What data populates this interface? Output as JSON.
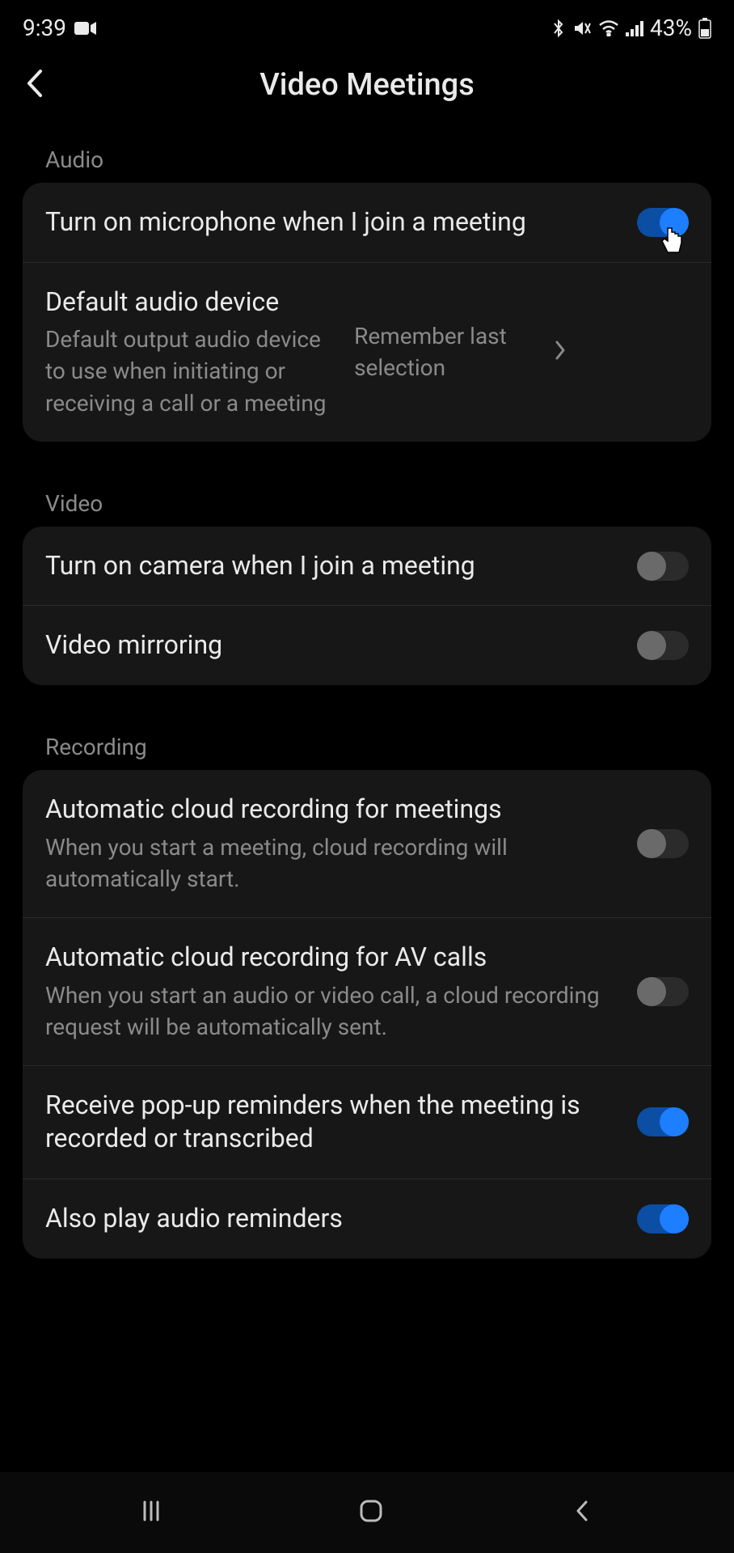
{
  "status": {
    "time": "9:39",
    "battery": "43%"
  },
  "header": {
    "title": "Video Meetings"
  },
  "sections": {
    "audio": {
      "label": "Audio",
      "mic_toggle": {
        "title": "Turn on microphone when I join a meeting"
      },
      "default_device": {
        "title": "Default audio device",
        "subtitle": "Default output audio device to use when initiating or receiving a call or a meeting",
        "value": "Remember last selection"
      }
    },
    "video": {
      "label": "Video",
      "camera_toggle": {
        "title": "Turn on camera when I join a meeting"
      },
      "mirroring": {
        "title": "Video mirroring"
      }
    },
    "recording": {
      "label": "Recording",
      "auto_meetings": {
        "title": "Automatic cloud recording for meetings",
        "subtitle": "When you start a meeting, cloud recording will automatically start."
      },
      "auto_av": {
        "title": "Automatic cloud recording for AV calls",
        "subtitle": "When you start an audio or video call, a cloud recording request will be automatically sent."
      },
      "popup_reminders": {
        "title": "Receive pop-up reminders when the meeting is recorded or transcribed"
      },
      "audio_reminders": {
        "title": "Also play audio reminders"
      }
    }
  }
}
